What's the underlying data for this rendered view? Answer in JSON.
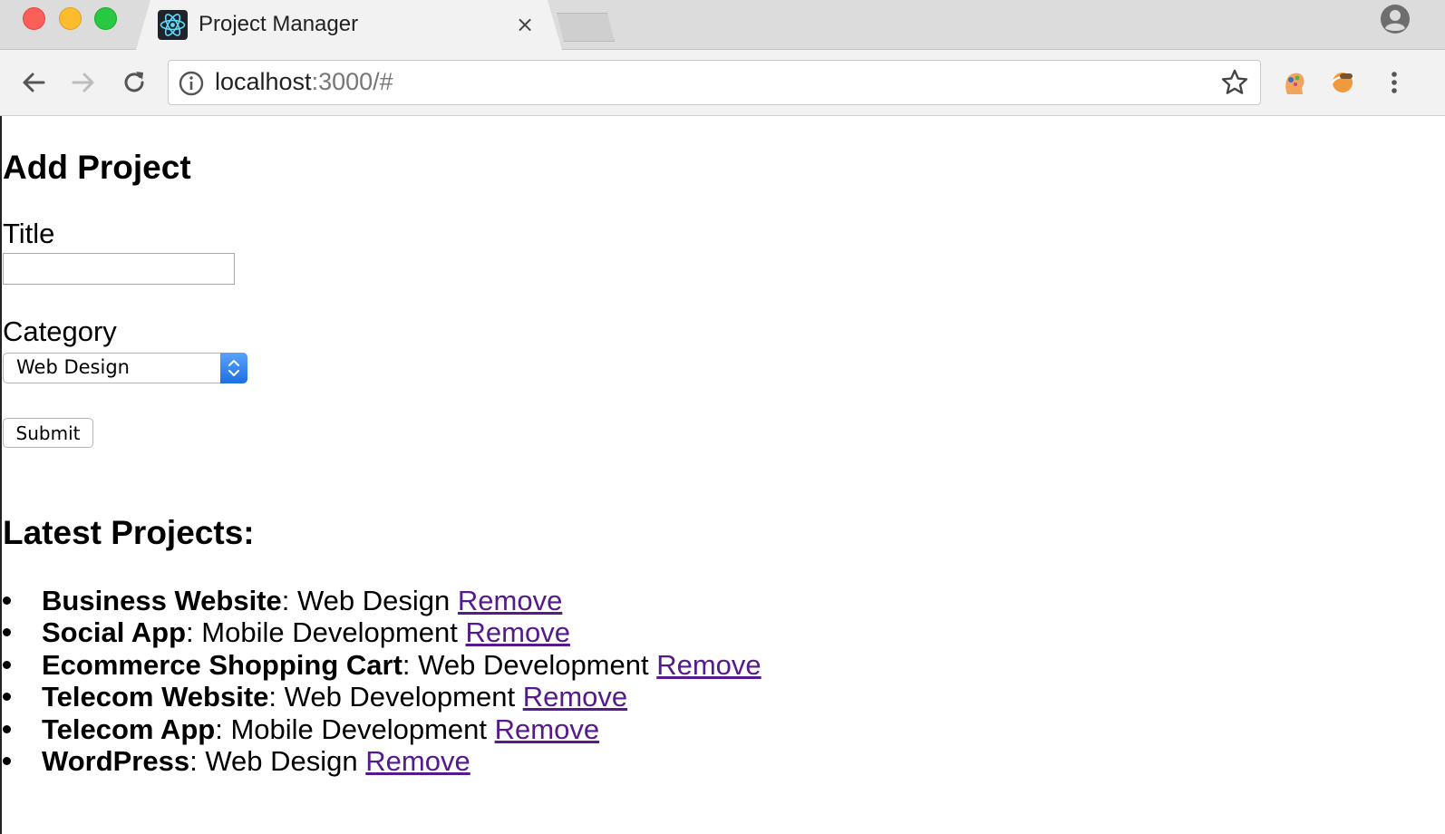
{
  "browser": {
    "tab_title": "Project Manager",
    "tab_close": "×",
    "url_host": "localhost",
    "url_path": ":3000/#",
    "colors": {
      "traffic_red": "#fc5f57",
      "traffic_yellow": "#fdbc2e",
      "traffic_green": "#28c840"
    },
    "icons": [
      "react-logo-icon",
      "close-icon",
      "profile-icon",
      "back-arrow-icon",
      "forward-arrow-icon",
      "reload-icon",
      "info-icon",
      "star-icon",
      "extension-icon",
      "menu-icon"
    ]
  },
  "form": {
    "heading": "Add Project",
    "title_label": "Title",
    "title_value": "",
    "category_label": "Category",
    "category_selected": "Web Design",
    "submit_label": "Submit"
  },
  "latest": {
    "heading": "Latest Projects:",
    "link_color": "#551a8b",
    "items": [
      {
        "title": "Business Website",
        "sep": ": ",
        "category": "Web Design",
        "action": "Remove"
      },
      {
        "title": "Social App",
        "sep": ": ",
        "category": "Mobile Development",
        "action": "Remove"
      },
      {
        "title": "Ecommerce Shopping Cart",
        "sep": ": ",
        "category": "Web Development",
        "action": "Remove"
      },
      {
        "title": "Telecom Website",
        "sep": ": ",
        "category": "Web Development",
        "action": "Remove"
      },
      {
        "title": "Telecom App",
        "sep": ": ",
        "category": "Mobile Development",
        "action": "Remove"
      },
      {
        "title": "WordPress",
        "sep": ": ",
        "category": "Web Design",
        "action": "Remove"
      }
    ]
  }
}
